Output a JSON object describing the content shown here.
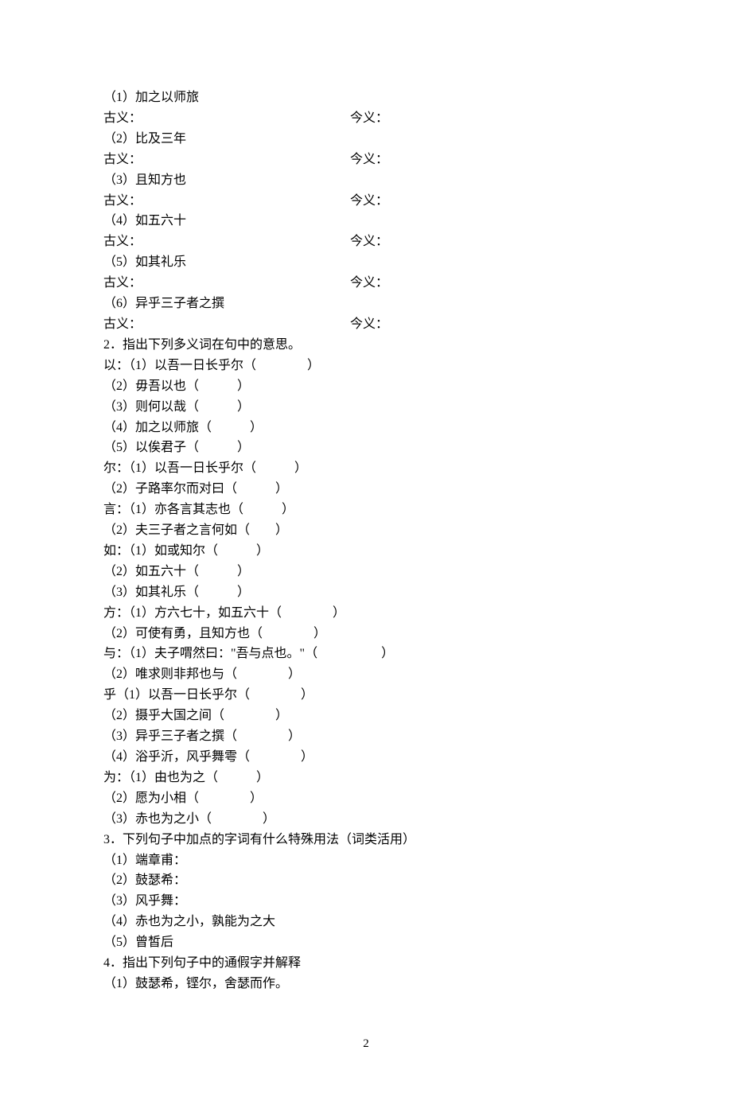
{
  "section1": {
    "items": [
      {
        "num": "（1）",
        "text": "加之以师旅"
      },
      {
        "num": "（2）",
        "text": "比及三年"
      },
      {
        "num": "（3）",
        "text": "且知方也"
      },
      {
        "num": "（4）",
        "text": "如五六十"
      },
      {
        "num": "（5）",
        "text": "如其礼乐"
      },
      {
        "num": "（6）",
        "text": "异乎三子者之撰"
      }
    ],
    "gu_label": "古义：",
    "jin_label": "今义："
  },
  "section2": {
    "heading": "2．指出下列多义词在句中的意思。",
    "groups": [
      {
        "word": "以",
        "items": [
          {
            "num": "（1）",
            "text": "以吾一日长乎尔（　　　　）"
          },
          {
            "num": "（2）",
            "text": "毋吾以也（　　　）"
          },
          {
            "num": "（3）",
            "text": "则何以哉（　　　）"
          },
          {
            "num": "（4）",
            "text": "加之以师旅（　　　）"
          },
          {
            "num": "（5）",
            "text": "以俟君子（　　　）"
          }
        ]
      },
      {
        "word": "尔",
        "items": [
          {
            "num": "（1）",
            "text": "以吾一日长乎尔（　　　）"
          },
          {
            "num": "（2）",
            "text": "子路率尔而对曰（　　　）"
          }
        ]
      },
      {
        "word": "言",
        "items": [
          {
            "num": "（1）",
            "text": "亦各言其志也（　　　）"
          },
          {
            "num": "（2）",
            "text": "夫三子者之言何如（　　）"
          }
        ]
      },
      {
        "word": "如",
        "items": [
          {
            "num": "（1）",
            "text": "如或知尔（　　　）"
          },
          {
            "num": "（2）",
            "text": "如五六十（　　　）"
          },
          {
            "num": "（3）",
            "text": "如其礼乐（　　　）"
          }
        ]
      },
      {
        "word": "方",
        "items": [
          {
            "num": "（1）",
            "text": "方六七十，如五六十（　　　　）"
          },
          {
            "num": "（2）",
            "text": "可使有勇，且知方也（　　　　）"
          }
        ]
      },
      {
        "word": "与",
        "items": [
          {
            "num": "（1）",
            "text": "夫子喟然曰：\"吾与点也。\"（　　　　　）"
          },
          {
            "num": "（2）",
            "text": "唯求则非邦也与（　　　　）"
          }
        ]
      },
      {
        "word": "乎",
        "items": [
          {
            "num": "（1）",
            "text": "以吾一日长乎尔（　　　　）"
          },
          {
            "num": "（2）",
            "text": "摄乎大国之间（　　　　）"
          },
          {
            "num": "（3）",
            "text": "异乎三子者之撰（　　　　）"
          },
          {
            "num": "（4）",
            "text": "浴乎沂，风乎舞雩（　　　　）"
          }
        ]
      },
      {
        "word": "为",
        "items": [
          {
            "num": "（1）",
            "text": "由也为之（　　　）"
          },
          {
            "num": "（2）",
            "text": "愿为小相（　　　　）"
          },
          {
            "num": "（3）",
            "text": "赤也为之小（　　　　）"
          }
        ]
      }
    ]
  },
  "section3": {
    "heading": "3．下列句子中加点的字词有什么特殊用法（词类活用）",
    "items": [
      {
        "num": "（1）",
        "text": "端章甫："
      },
      {
        "num": "（2）",
        "text": "鼓瑟希："
      },
      {
        "num": "（3）",
        "text": "风乎舞："
      },
      {
        "num": "（4）",
        "text": "赤也为之小，孰能为之大"
      },
      {
        "num": "（5）",
        "text": "曾皙后"
      }
    ]
  },
  "section4": {
    "heading": "4．指出下列句子中的通假字并解释",
    "items": [
      {
        "num": "（1）",
        "text": "鼓瑟希，铿尔，舍瑟而作。"
      }
    ]
  },
  "page_number": "2"
}
